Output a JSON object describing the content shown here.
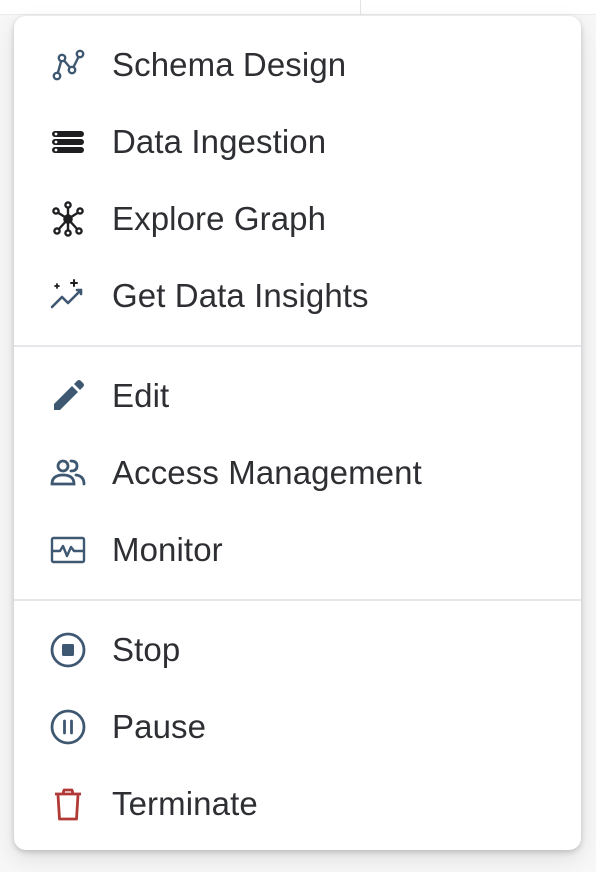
{
  "menu": {
    "groups": [
      {
        "items": [
          {
            "label": "Schema Design",
            "icon": "schema-graph-icon"
          },
          {
            "label": "Data Ingestion",
            "icon": "database-stack-icon"
          },
          {
            "label": "Explore Graph",
            "icon": "network-explore-icon"
          },
          {
            "label": "Get Data Insights",
            "icon": "sparkle-trend-icon"
          }
        ]
      },
      {
        "items": [
          {
            "label": "Edit",
            "icon": "pencil-icon"
          },
          {
            "label": "Access Management",
            "icon": "people-icon"
          },
          {
            "label": "Monitor",
            "icon": "monitor-pulse-icon"
          }
        ]
      },
      {
        "items": [
          {
            "label": "Stop",
            "icon": "stop-circle-icon"
          },
          {
            "label": "Pause",
            "icon": "pause-circle-icon"
          },
          {
            "label": "Terminate",
            "icon": "trash-icon"
          }
        ]
      }
    ]
  },
  "colors": {
    "icon": "#3f5872",
    "icon_dark": "#1f1f22",
    "danger": "#b23a36",
    "text": "#2e2f33",
    "separator": "#e6e7ea"
  }
}
